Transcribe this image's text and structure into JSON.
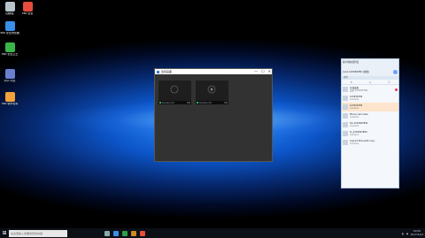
{
  "desktop": {
    "icons": [
      {
        "label": "回收站",
        "color": "#b8c4cc"
      },
      {
        "label": "360 安全",
        "color": "#e84c3d"
      },
      {
        "label": "360 安全浏览器",
        "color": "#3a8fe8"
      },
      {
        "label": "360 安全卫士",
        "color": "#39b54a"
      },
      {
        "label": "php 环境",
        "color": "#6a7fd0"
      },
      {
        "label": "360 软件管家",
        "color": "#f3a33a"
      }
    ]
  },
  "video_window": {
    "title": "监控画面",
    "controls": [
      "—",
      "☐",
      "✕"
    ],
    "tiles": [
      {
        "label": "Camera 01",
        "status": "ON"
      },
      {
        "label": "Camera 02",
        "status": "ON"
      }
    ]
  },
  "side_panel": {
    "header": "客户端在线列表",
    "account": "xxxx 123456789 (在线)",
    "search_placeholder": "搜索",
    "tabs": [
      "★",
      "◎",
      "☰"
    ],
    "items": [
      {
        "name": "在线设备",
        "sub": "设备 123456789",
        "selected": false,
        "badge": true
      },
      {
        "name": "123456789",
        "sub": "xxxxxxx",
        "selected": false,
        "badge": false
      },
      {
        "name": "123456789",
        "sub": "xxxxxxx",
        "selected": true,
        "badge": false
      },
      {
        "name": "Phone cell name",
        "sub": "xxxxxxx",
        "selected": false,
        "badge": false
      },
      {
        "name": "QA 1234567890",
        "sub": "xxxxxxx",
        "selected": false,
        "badge": false
      },
      {
        "name": "fo_1234567890",
        "sub": "xxxxxxx",
        "selected": false,
        "badge": false
      },
      {
        "name": "client 0 Microsoft corp..",
        "sub": "xxxxxxx",
        "selected": false,
        "badge": false
      }
    ]
  },
  "taskbar": {
    "start": "⊞",
    "search_placeholder": "在这里输入你要搜索的内容",
    "apps": [
      "#8aa",
      "#3a8fe8",
      "#2aa04a",
      "#cc8a22",
      "#e84c3d"
    ],
    "time": "10:20",
    "date": "2017/12/4"
  }
}
